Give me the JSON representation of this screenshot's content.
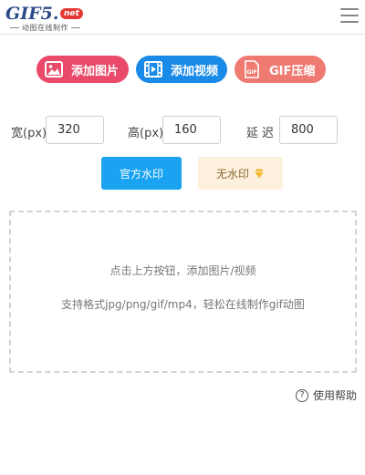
{
  "header": {
    "logo_text": "GIF5.",
    "logo_badge": "net",
    "logo_subtitle": "动图在线制作",
    "menu_icon": "hamburger-menu-icon"
  },
  "actions": {
    "add_image": {
      "label": "添加图片",
      "icon": "image-icon",
      "color": "#e94a6a"
    },
    "add_video": {
      "label": "添加视频",
      "icon": "film-icon",
      "color": "#1a8ae8"
    },
    "gif_compress": {
      "label": "GIF压缩",
      "icon": "gif-file-icon",
      "color": "#ef7a72"
    }
  },
  "settings": {
    "width_label": "宽(px)",
    "width_value": "320",
    "height_label": "高(px)",
    "height_value": "160",
    "delay_label": "延迟",
    "delay_value": "800"
  },
  "watermark": {
    "official_label": "官方水印",
    "no_watermark_label": "无水印",
    "no_watermark_icon": "diamond-icon"
  },
  "dropzone": {
    "line1": "点击上方按钮，添加图片/视频",
    "line2": "支持格式jpg/png/gif/mp4，轻松在线制作gif动图"
  },
  "help": {
    "label": "使用帮助",
    "icon": "question-circle-icon"
  }
}
